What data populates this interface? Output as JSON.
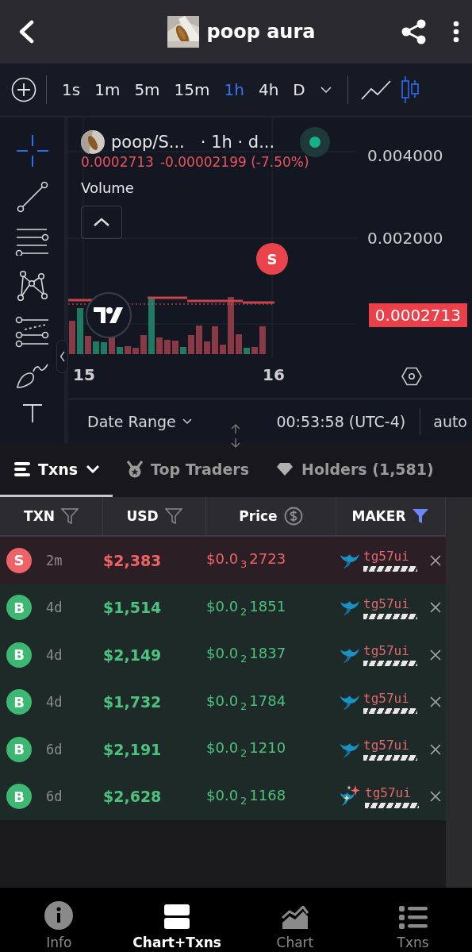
{
  "header": {
    "title": "poop aura"
  },
  "toolbar": {
    "intervals": [
      {
        "label": "1s",
        "selected": false
      },
      {
        "label": "1m",
        "selected": false
      },
      {
        "label": "5m",
        "selected": false
      },
      {
        "label": "15m",
        "selected": false
      },
      {
        "label": "1h",
        "selected": true
      },
      {
        "label": "4h",
        "selected": false
      },
      {
        "label": "D",
        "selected": false
      }
    ],
    "chart_types": [
      {
        "kind": "line",
        "selected": false
      },
      {
        "kind": "candles",
        "selected": true
      }
    ]
  },
  "drawing_tools": [
    {
      "kind": "crosshair",
      "selected": true
    },
    {
      "kind": "trend_line",
      "selected": false
    },
    {
      "kind": "fib",
      "selected": false
    },
    {
      "kind": "pattern",
      "selected": false
    },
    {
      "kind": "channel",
      "selected": false
    },
    {
      "kind": "brush",
      "selected": false
    },
    {
      "kind": "text",
      "selected": false
    }
  ],
  "chart": {
    "symbol": "poop/S...",
    "interval_info": "· 1h · d...",
    "live": true,
    "last_price": "0.0002713",
    "change": "-0.00002199 (-7.50%)",
    "indicator": "Volume",
    "price_labels": [
      "0.004000",
      "0.002000"
    ],
    "current_price_tag": "0.0002713",
    "trade_marker": "S",
    "time_labels": [
      "15",
      "16"
    ],
    "date_range": "Date Range",
    "clock": "00:53:58 (UTC-4)",
    "scale_mode": "auto"
  },
  "tabs": [
    {
      "label": "Txns",
      "kind": "txns",
      "selected": true
    },
    {
      "label": "Top Traders",
      "kind": "traders",
      "selected": false
    },
    {
      "label": "Holders (1,581)",
      "kind": "holders",
      "selected": false
    }
  ],
  "table": {
    "columns": [
      {
        "label": "TXN",
        "kind": "filter",
        "active": false
      },
      {
        "label": "USD",
        "kind": "filter",
        "active": false
      },
      {
        "label": "Price",
        "kind": "currency",
        "active": false
      },
      {
        "label": "MAKER",
        "kind": "filter",
        "active": true
      }
    ],
    "rows": [
      {
        "kind": "sell",
        "badge": "S",
        "age": "2m",
        "usd": "$2,383",
        "price": "$0.0$_{3}$2723",
        "maker_icon": {
          "kind": "whale"
        },
        "maker": "tg57ui"
      },
      {
        "kind": "buy",
        "badge": "B",
        "age": "4d",
        "usd": "$1,514",
        "price": "$0.0$_{2}$1851",
        "maker_icon": {
          "kind": "whale"
        },
        "maker": "tg57ui"
      },
      {
        "kind": "buy",
        "badge": "B",
        "age": "4d",
        "usd": "$2,149",
        "price": "$0.0$_{2}$1837",
        "maker_icon": {
          "kind": "whale"
        },
        "maker": "tg57ui"
      },
      {
        "kind": "buy",
        "badge": "B",
        "age": "4d",
        "usd": "$1,732",
        "price": "$0.0$_{2}$1784",
        "maker_icon": {
          "kind": "whale"
        },
        "maker": "tg57ui"
      },
      {
        "kind": "buy",
        "badge": "B",
        "age": "6d",
        "usd": "$2,191",
        "price": "$0.0$_{2}$1210",
        "maker_icon": {
          "kind": "whale"
        },
        "maker": "tg57ui"
      },
      {
        "kind": "buy",
        "badge": "B",
        "age": "6d",
        "usd": "$2,628",
        "price": "$0.0$_{2}$1168",
        "maker_icon": {
          "kind": "new_whale"
        },
        "maker": "tg57ui"
      }
    ]
  },
  "bottom_nav": [
    {
      "label": "Info",
      "kind": "info",
      "selected": false
    },
    {
      "label": "Chart+Txns",
      "kind": "split",
      "selected": true
    },
    {
      "label": "Chart",
      "kind": "chart",
      "selected": false
    },
    {
      "label": "Txns",
      "kind": "list",
      "selected": false
    }
  ]
}
